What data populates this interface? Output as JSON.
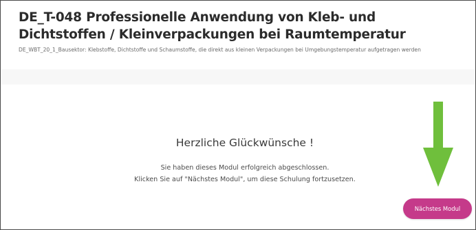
{
  "header": {
    "title": "DE_T-048 Professionelle Anwendung von Kleb- und Dichtstoffen / Kleinverpackungen bei Raumtemperatur",
    "subtitle": "DE_WBT_20_1_Bausektor: Klebstoffe, Dichtstoffe und Schaumstoffe, die direkt aus kleinen Verpackungen bei Umgebungstemperatur aufgetragen werden"
  },
  "completion": {
    "heading": "Herzliche Glückwünsche !",
    "line1": "Sie haben dieses Modul erfolgreich abgeschlossen.",
    "line2": "Klicken Sie auf \"Nächstes Modul\", um diese Schulung fortzusetzen."
  },
  "next_button": {
    "label": "Nächstes Modul"
  },
  "colors": {
    "button": "#c53a8a",
    "arrow": "#6fbf3c",
    "title": "#2b2b2b"
  },
  "icons": {
    "annotation": "arrow-down-icon"
  }
}
